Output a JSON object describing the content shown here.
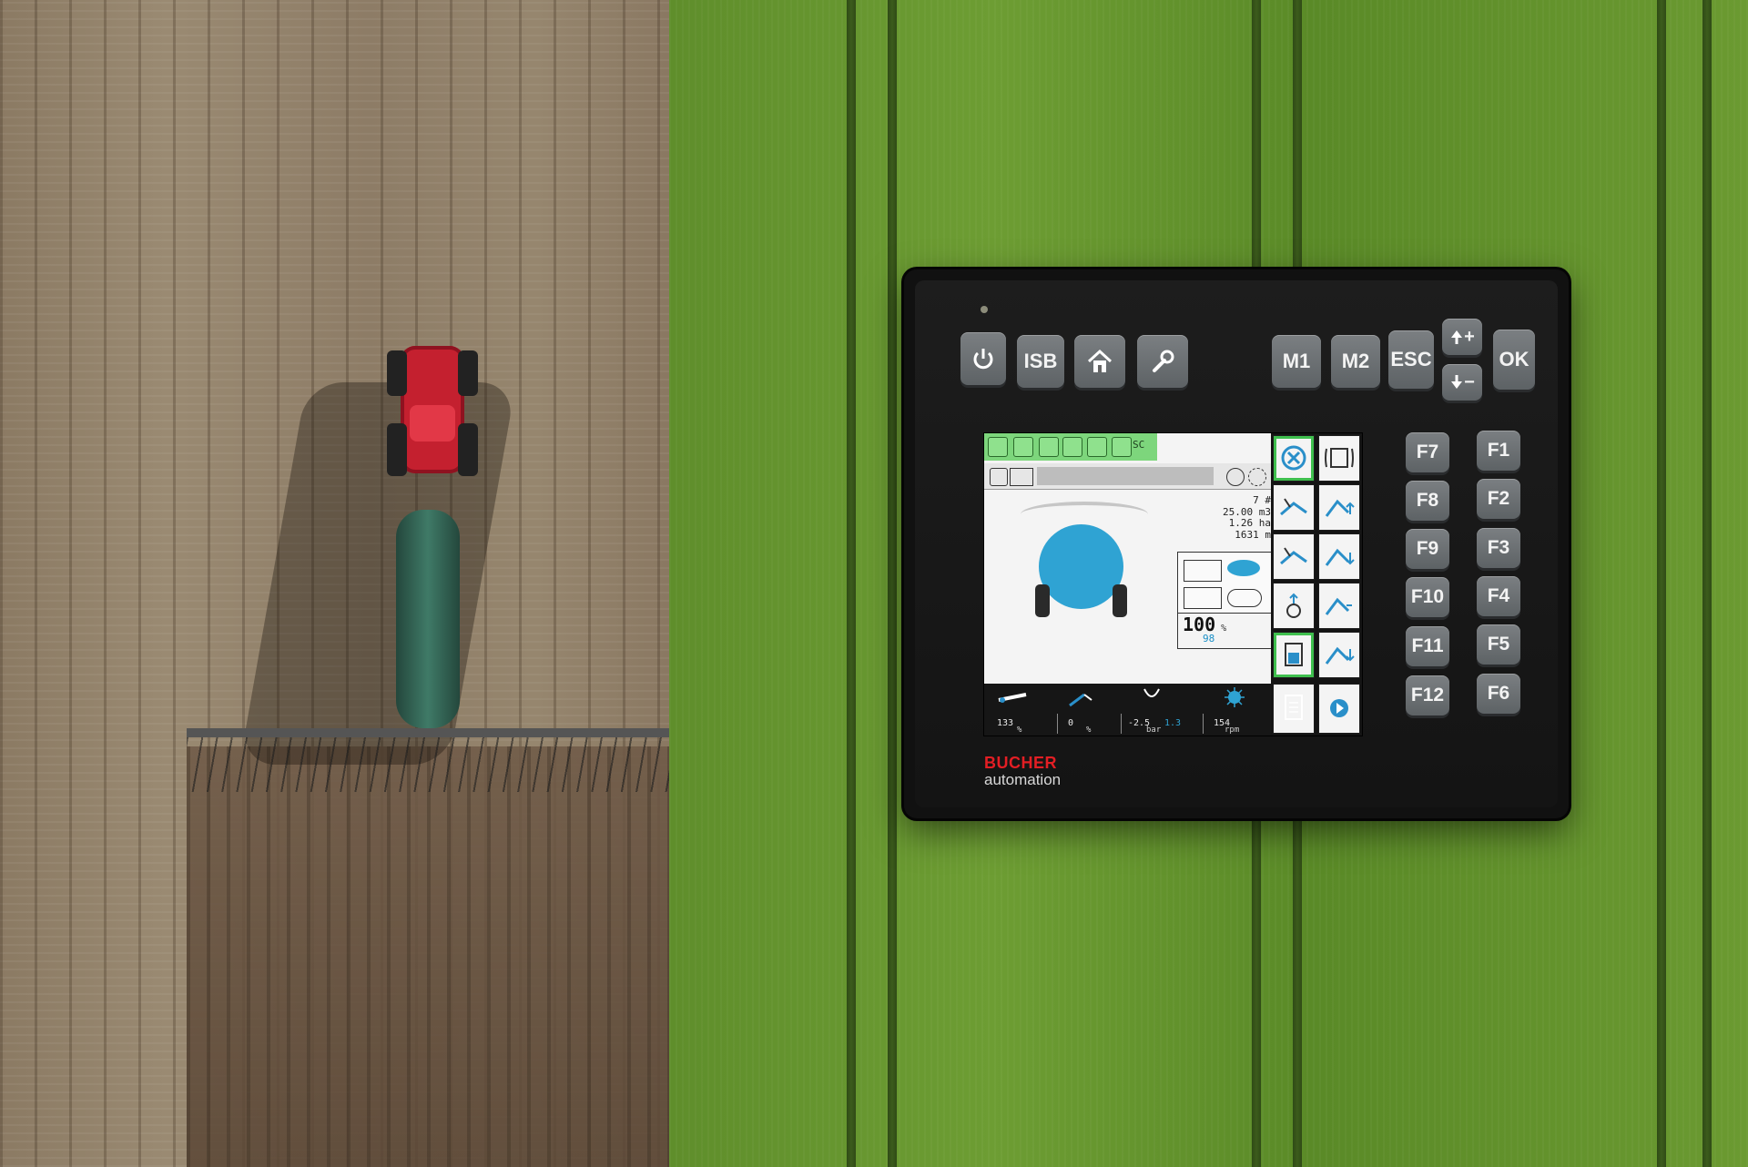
{
  "brand": {
    "name": "BUCHER",
    "subtitle": "automation"
  },
  "top_keys": {
    "power": "power-icon",
    "isb": "ISB",
    "home": "home-icon",
    "settings": "wrench-icon",
    "m1": "M1",
    "m2": "M2",
    "esc": "ESC",
    "plus": "+",
    "minus": "−",
    "ok": "OK"
  },
  "function_keys": {
    "left": [
      "F7",
      "F8",
      "F9",
      "F10",
      "F11",
      "F12"
    ],
    "right": [
      "F1",
      "F2",
      "F3",
      "F4",
      "F5",
      "F6"
    ]
  },
  "screen": {
    "toolbar": {
      "sc_label": "SC"
    },
    "stats": [
      "7 #",
      "25.00 m3",
      "1.26 ha",
      "1631 m"
    ],
    "rate": {
      "value": "100",
      "unit": "%",
      "sub": "98"
    },
    "bottom": {
      "c1": {
        "value": "133",
        "unit": "%"
      },
      "c2": {
        "value": "0",
        "unit": "%"
      },
      "c3": {
        "value": "-2.5",
        "value2": "1.3",
        "unit": "bar"
      },
      "c4": {
        "value": "154",
        "unit": "rpm"
      }
    }
  },
  "colors": {
    "toolbar_green": "#7dd67c",
    "tank_blue": "#2fa3d3",
    "softkey_blue": "#2a8fc9",
    "brand_red": "#e31e24"
  }
}
